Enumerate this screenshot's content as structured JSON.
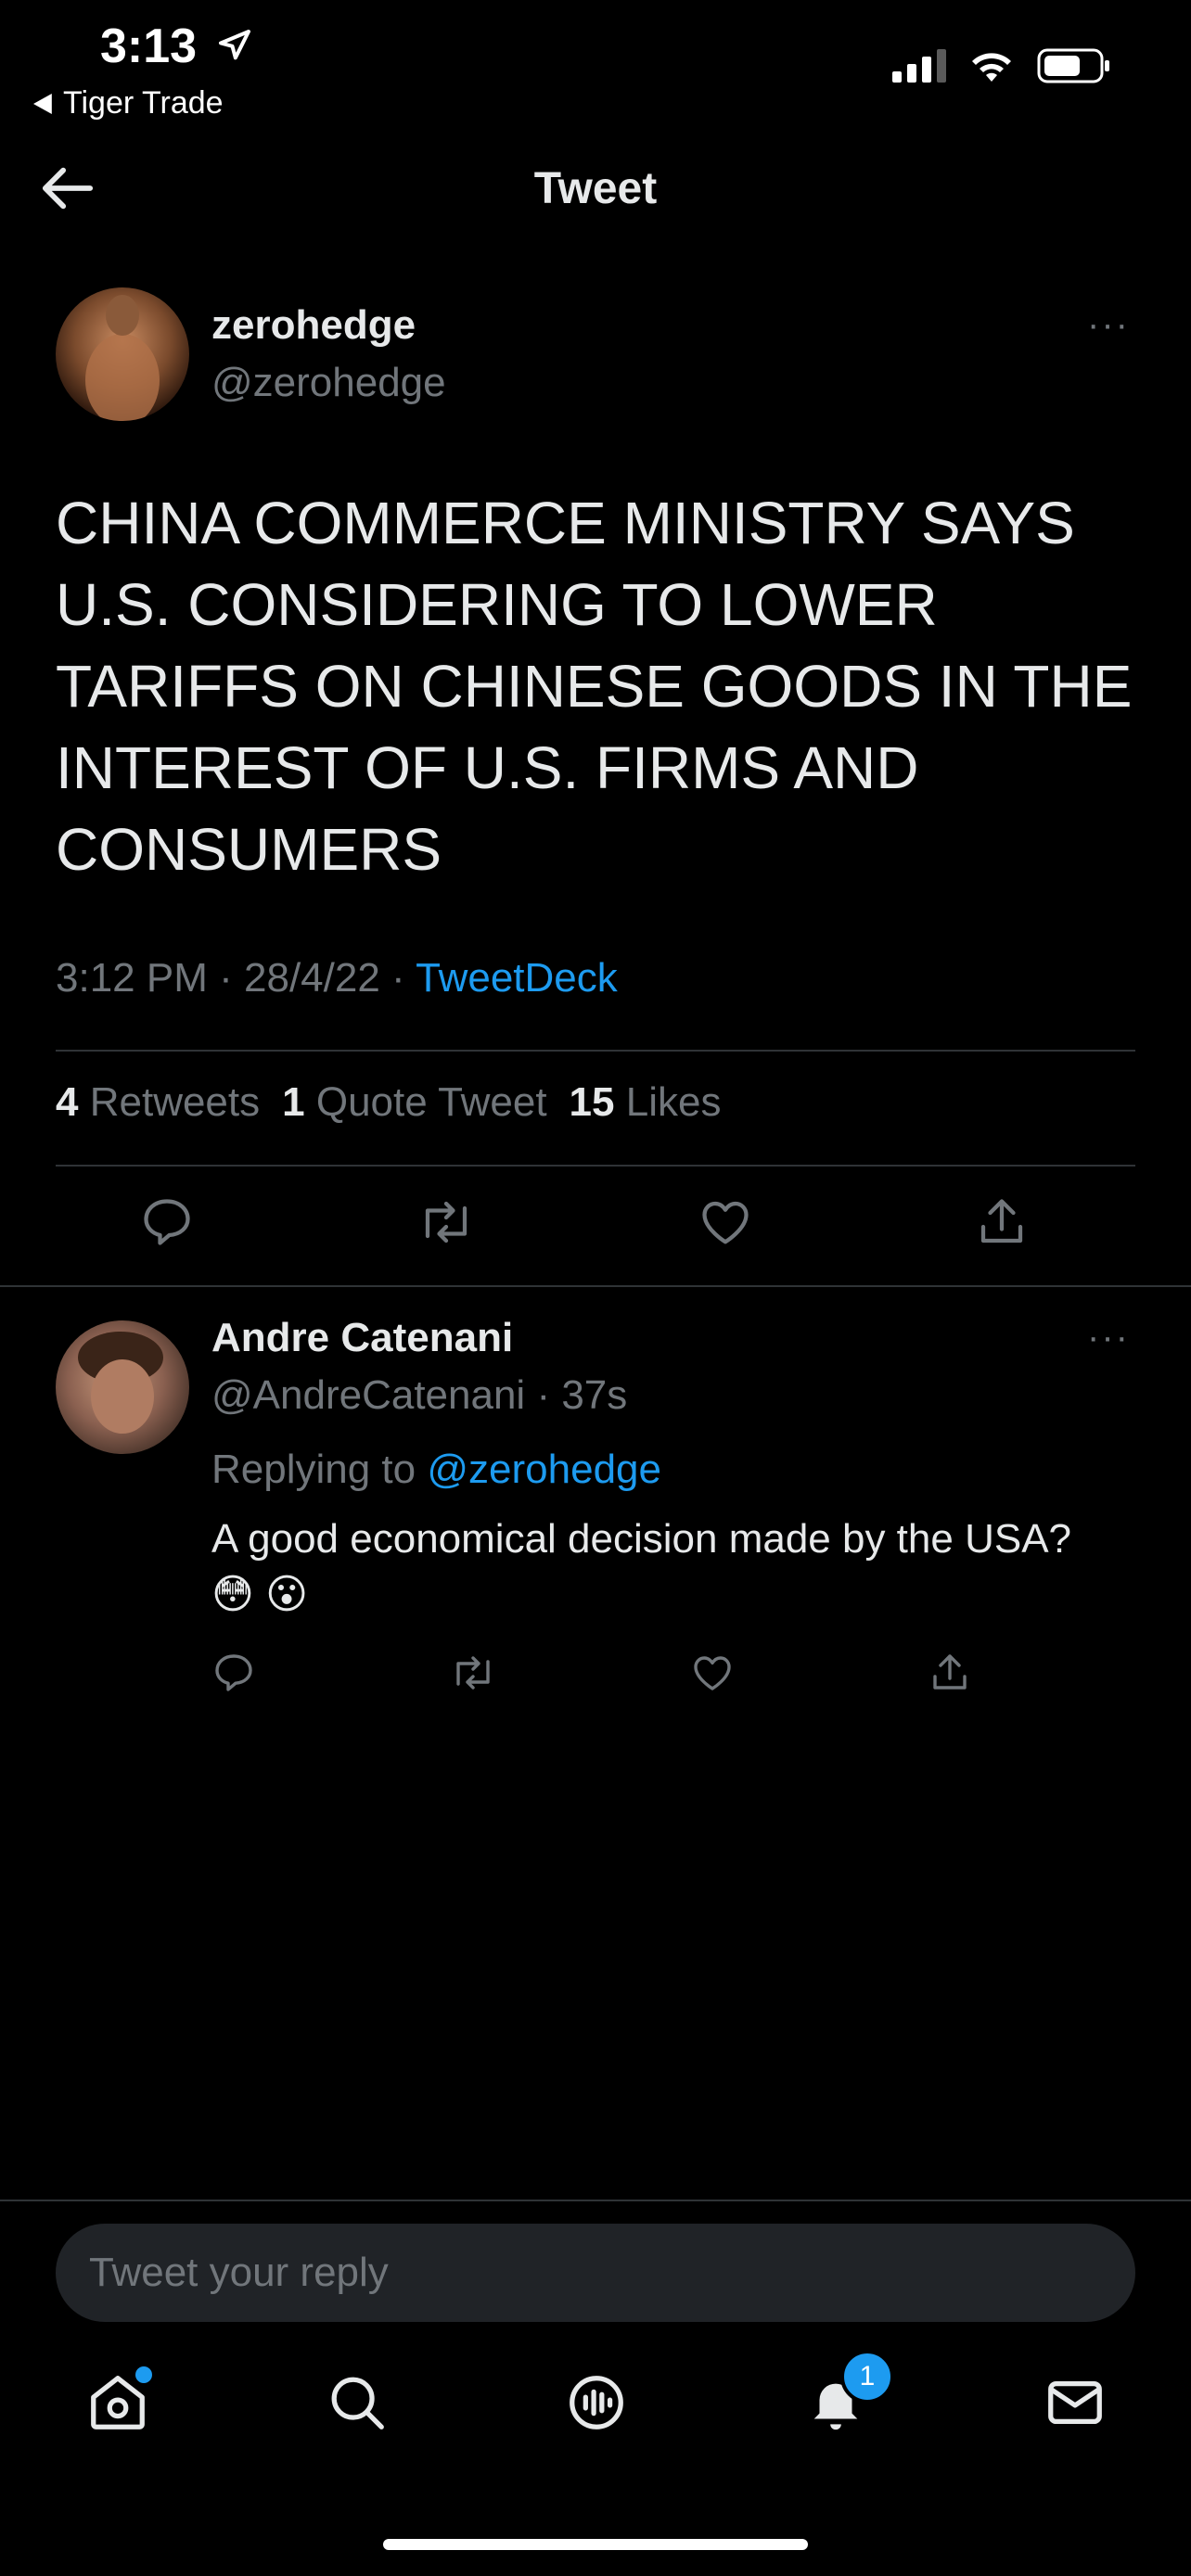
{
  "status_bar": {
    "time": "3:13",
    "back_app_label": "Tiger Trade"
  },
  "header": {
    "title": "Tweet"
  },
  "main_tweet": {
    "name": "zerohedge",
    "handle": "@zerohedge",
    "more": "···",
    "text": "CHINA COMMERCE MINISTRY SAYS U.S. CONSIDERING TO LOWER TARIFFS ON CHINESE GOODS IN THE INTEREST OF U.S. FIRMS AND CONSUMERS",
    "time": "3:12 PM",
    "date": "28/4/22",
    "source": "TweetDeck",
    "retweets_count": "4",
    "retweets_label": "Retweets",
    "quotes_count": "1",
    "quotes_label": "Quote Tweet",
    "likes_count": "15",
    "likes_label": "Likes"
  },
  "reply": {
    "name": "Andre Catenani",
    "handle": "@AndreCatenani",
    "age": "37s",
    "more": "···",
    "replying_label": "Replying to",
    "replying_to": "@zerohedge",
    "text": "A good economical decision made by the USA? 😳 😮"
  },
  "compose": {
    "placeholder": "Tweet your reply"
  },
  "tabbar": {
    "notifications_badge": "1"
  },
  "colors": {
    "accent": "#1d9bf0",
    "background": "#000000",
    "muted": "#71767b"
  }
}
